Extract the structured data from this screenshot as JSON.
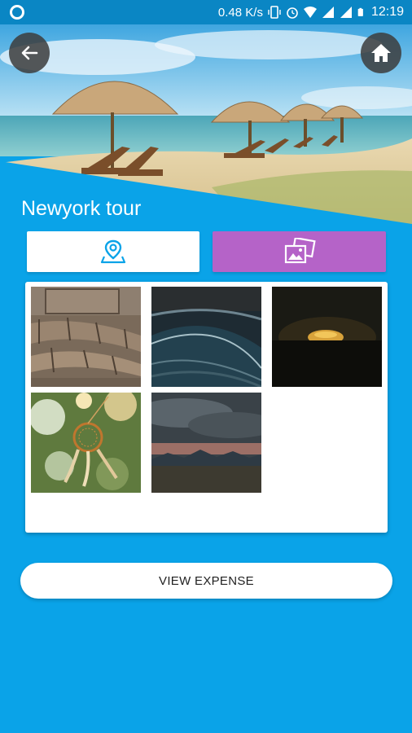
{
  "status_bar": {
    "speed": "0.48 K/s",
    "time": "12:19",
    "icons": [
      "circle-notification-icon",
      "vibrate-icon",
      "alarm-icon",
      "wifi-icon",
      "signal-icon",
      "signal-icon-2",
      "battery-icon"
    ]
  },
  "header": {
    "back_icon": "arrow-left-icon",
    "home_icon": "home-icon"
  },
  "trip": {
    "title": "Newyork tour"
  },
  "tabs": [
    {
      "icon": "map-pin-icon",
      "selected": false,
      "color": "#ffffff"
    },
    {
      "icon": "image-gallery-icon",
      "selected": true,
      "color": "#b563c8"
    }
  ],
  "gallery": {
    "photos": [
      {
        "subject": "stone-wall-photo"
      },
      {
        "subject": "ocean-wave-photo"
      },
      {
        "subject": "night-sun-photo"
      },
      {
        "subject": "dreamcatcher-photo"
      },
      {
        "subject": "cloudy-mountains-photo"
      }
    ]
  },
  "actions": {
    "view_expense_label": "VIEW EXPENSE"
  },
  "colors": {
    "background": "#0aa3e8",
    "status_bar": "#0a86c4",
    "accent": "#b563c8"
  }
}
